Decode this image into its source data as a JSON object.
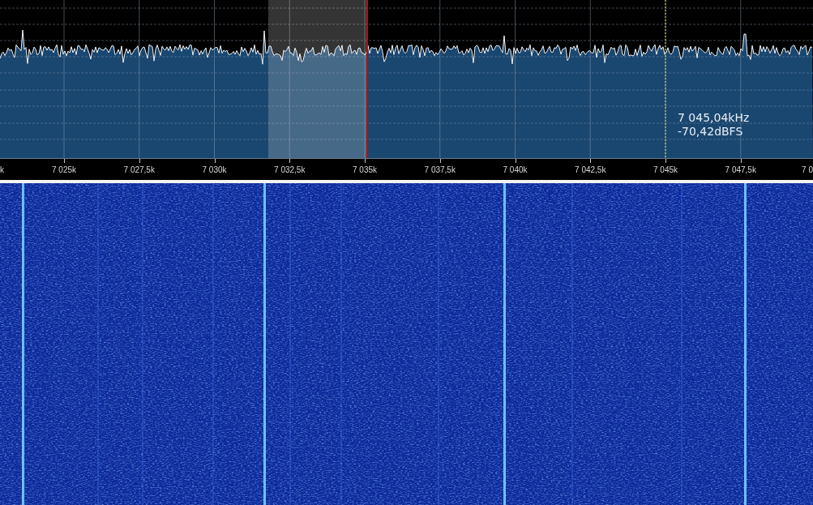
{
  "spectrum": {
    "readout": {
      "frequency": "7 045,04kHz",
      "power": "-70,42dBFS"
    }
  },
  "axis": {
    "labels": [
      "k",
      "7 025k",
      "7 027,5k",
      "7 030k",
      "7 032,5k",
      "7 035k",
      "7 037,5k",
      "7 040k",
      "7 042,5k",
      "7 045k",
      "7 047,5k",
      "7 0"
    ]
  }
}
